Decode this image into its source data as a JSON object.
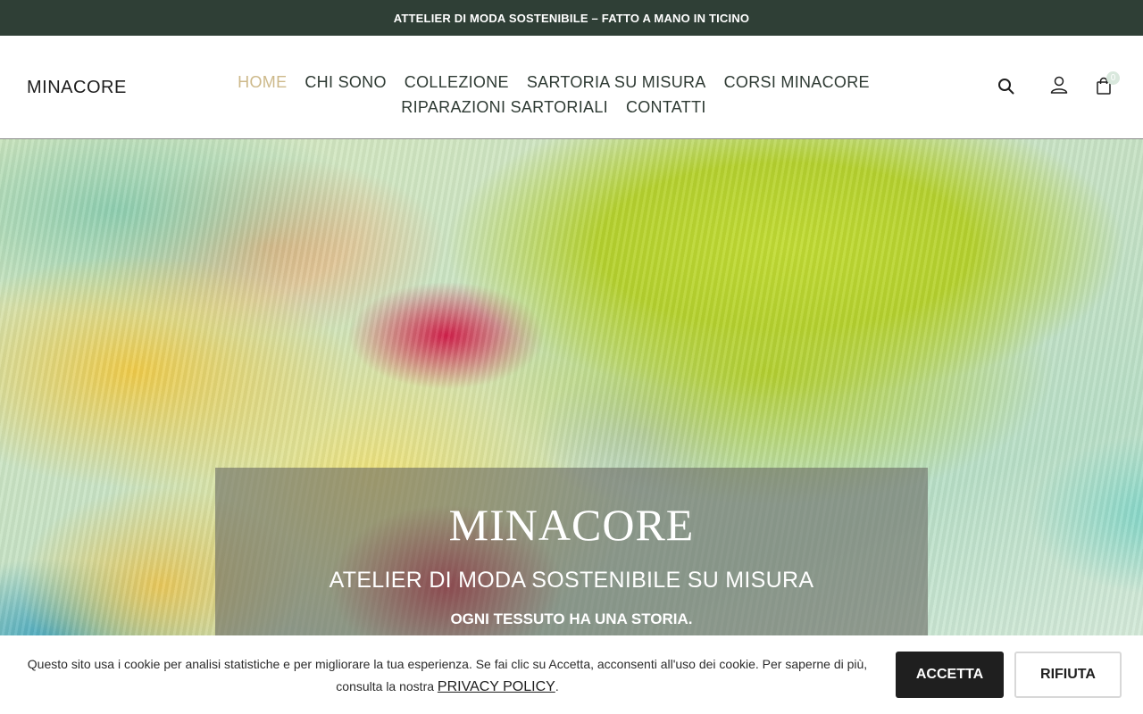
{
  "announcement": "ATTELIER DI MODA SOSTENIBILE – FATTO A MANO IN TICINO",
  "header": {
    "logo": "MINACORE",
    "nav": [
      {
        "label": "HOME",
        "active": true
      },
      {
        "label": "CHI SONO"
      },
      {
        "label": "COLLEZIONE"
      },
      {
        "label": "SARTORIA SU MISURA"
      },
      {
        "label": "CORSI MINACORE"
      },
      {
        "label": "RIPARAZIONI SARTORIALI"
      },
      {
        "label": "CONTATTI"
      }
    ],
    "icons": [
      "search-icon",
      "user-icon",
      "shopping-bag-icon"
    ],
    "cart_count": "0"
  },
  "hero": {
    "title": "MINACORE",
    "subtitle": "ATELIER DI MODA SOSTENIBILE SU MISURA",
    "tagline": "OGNI TESSUTO HA UNA STORIA."
  },
  "cookie_banner": {
    "text": "Questo sito usa i cookie per analisi statistiche e per migliorare la tua esperienza. Se fai clic su Accetta, acconsenti all'uso dei cookie. Per saperne di più, consulta la nostra",
    "link": "PRIVACY POLICY",
    "end": ".",
    "accept": "ACCETTA",
    "reject": "RIFIUTA"
  },
  "colors": {
    "announcement_bg": "#2f3f36",
    "nav_active": "#cdb98a",
    "accept_bg": "#1f1f1f"
  }
}
